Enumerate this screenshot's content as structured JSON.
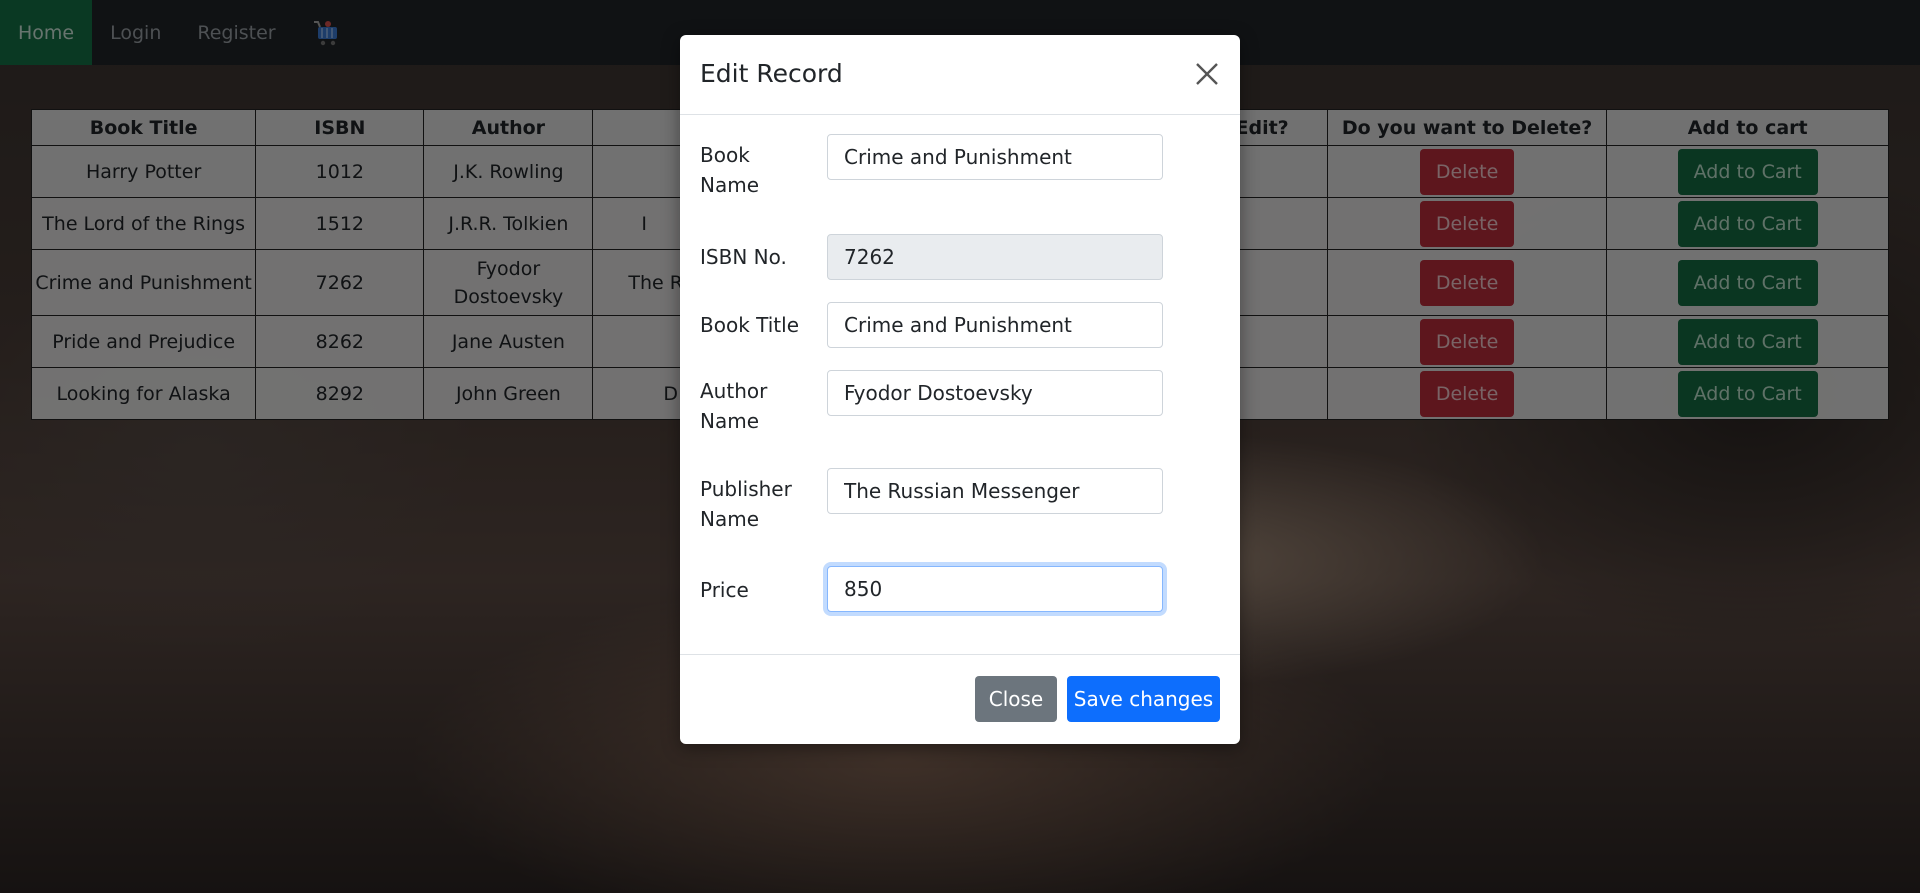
{
  "navbar": {
    "items": [
      {
        "label": "Home",
        "active": true
      },
      {
        "label": "Login"
      },
      {
        "label": "Register"
      }
    ],
    "cart_icon": "shopping-cart-icon"
  },
  "table": {
    "headers": [
      "Book Title",
      "ISBN",
      "Author",
      "",
      "Edit?",
      "Do you want to Delete?",
      "Add to cart"
    ],
    "rows": [
      {
        "title": "Harry Potter",
        "isbn": "1012",
        "author": "J.K. Rowling",
        "publisher": "",
        "delete": "Delete",
        "cart": "Add to Cart"
      },
      {
        "title": "The Lord of the Rings",
        "isbn": "1512",
        "author": "J.R.R. Tolkien",
        "publisher": "I",
        "delete": "Delete",
        "cart": "Add to Cart"
      },
      {
        "title": "Crime and Punishment",
        "isbn": "7262",
        "author": "Fyodor Dostoevsky",
        "publisher": "The R",
        "delete": "Delete",
        "cart": "Add to Cart"
      },
      {
        "title": "Pride and Prejudice",
        "isbn": "8262",
        "author": "Jane Austen",
        "publisher": "",
        "delete": "Delete",
        "cart": "Add to Cart"
      },
      {
        "title": "Looking for Alaska",
        "isbn": "8292",
        "author": "John Green",
        "publisher": "D",
        "delete": "Delete",
        "cart": "Add to Cart"
      }
    ]
  },
  "modal": {
    "title": "Edit Record",
    "close_icon": "close-icon",
    "fields": {
      "book_name": {
        "label": "Book Name",
        "value": "Crime and Punishment"
      },
      "isbn": {
        "label": "ISBN No.",
        "value": "7262"
      },
      "book_title": {
        "label": "Book Title",
        "value": "Crime and Punishment"
      },
      "author_name": {
        "label": "Author Name",
        "value": "Fyodor Dostoevsky"
      },
      "publisher_name": {
        "label": "Publisher Name",
        "value": "The Russian Messenger"
      },
      "price": {
        "label": "Price",
        "value": "850"
      }
    },
    "close_label": "Close",
    "save_label": "Save changes"
  },
  "colors": {
    "nav_active": "#157347",
    "delete": "#bb2d3b",
    "add_to_cart": "#146c43",
    "primary": "#0d6efd",
    "secondary": "#6c757d"
  }
}
